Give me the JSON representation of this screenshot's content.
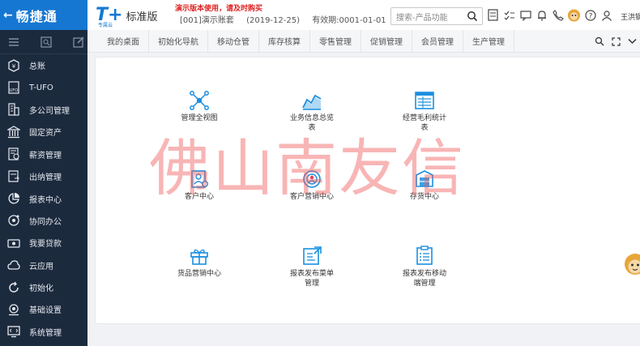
{
  "brand": {
    "back_glyph": "←",
    "name": "畅捷通"
  },
  "product": {
    "logo_text": "T+",
    "logo_sub": "专属云",
    "edition": "标准版"
  },
  "demo_notice": "演示版本使用，请及时购买",
  "account": {
    "name": "[001]演示账套",
    "date": "(2019-12-25)",
    "validity": "有效期:0001-01-01"
  },
  "search": {
    "placeholder": "搜索-产品功能"
  },
  "user": {
    "name": "王洪钢"
  },
  "toolbar_icons": [
    "calculator-icon",
    "checklist-icon",
    "message-icon",
    "bell-icon",
    "phone-icon",
    "mascot-icon",
    "help-icon",
    "user-icon"
  ],
  "sidebar": {
    "items": [
      {
        "label": "总账",
        "icon": "ledger-icon"
      },
      {
        "label": "T-UFO",
        "icon": "ufo-icon"
      },
      {
        "label": "多公司管理",
        "icon": "building-icon"
      },
      {
        "label": "固定资产",
        "icon": "bank-icon"
      },
      {
        "label": "薪资管理",
        "icon": "salary-icon"
      },
      {
        "label": "出纳管理",
        "icon": "cashier-icon"
      },
      {
        "label": "报表中心",
        "icon": "pie-chart-icon"
      },
      {
        "label": "协同办公",
        "icon": "collaboration-icon"
      },
      {
        "label": "我要贷款",
        "icon": "loan-icon"
      },
      {
        "label": "云应用",
        "icon": "cloud-icon"
      },
      {
        "label": "初始化",
        "icon": "refresh-icon"
      },
      {
        "label": "基础设置",
        "icon": "settings-icon"
      },
      {
        "label": "系统管理",
        "icon": "system-icon"
      }
    ]
  },
  "tabs": [
    "我的桌面",
    "初始化导航",
    "移动仓管",
    "库存核算",
    "零售管理",
    "促销管理",
    "会员管理",
    "生产管理"
  ],
  "functions": [
    {
      "label": "管理全视图",
      "icon": "network-icon"
    },
    {
      "label": "业务信息总览表",
      "icon": "chart-area-icon"
    },
    {
      "label": "经营毛利统计表",
      "icon": "spreadsheet-icon"
    },
    {
      "label": "客户中心",
      "icon": "customer-icon"
    },
    {
      "label": "客户营销中心",
      "icon": "target-icon"
    },
    {
      "label": "存货中心",
      "icon": "inventory-icon"
    },
    {
      "label": "货品营销中心",
      "icon": "gift-icon"
    },
    {
      "label": "报表发布菜单管理",
      "icon": "report-publish-icon"
    },
    {
      "label": "报表发布移动端管理",
      "icon": "mobile-report-icon"
    }
  ],
  "watermark": "佛山南友信",
  "colors": {
    "brand_blue": "#1677d2",
    "sidebar_bg": "#1c2a3e",
    "icon_blue": "#1b8fe0",
    "warning_red": "#e02020",
    "watermark": "#f05a5a"
  }
}
